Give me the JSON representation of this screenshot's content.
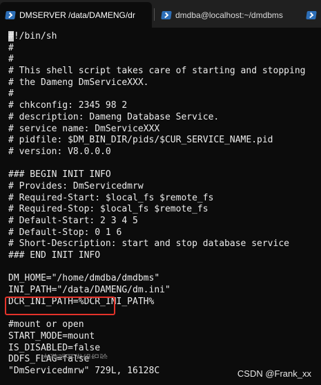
{
  "tabs": [
    {
      "title": "DMSERVER /data/DAMENG/dr",
      "active": true,
      "icon": "powershell-icon"
    },
    {
      "title": "dmdba@localhost:~/dmdbms",
      "active": false,
      "icon": "powershell-icon"
    },
    {
      "title": "",
      "active": false,
      "icon": "powershell-icon"
    }
  ],
  "terminal": {
    "lines": [
      "#!/bin/sh",
      "#",
      "#",
      "# This shell script takes care of starting and stopping",
      "# the Dameng DmServiceXXX.",
      "#",
      "# chkconfig: 2345 98 2",
      "# description: Dameng Database Service.",
      "# service name: DmServiceXXX",
      "# pidfile: $DM_BIN_DIR/pids/$CUR_SERVICE_NAME.pid",
      "# version: V8.0.0.0",
      "",
      "### BEGIN INIT INFO",
      "# Provides: DmServicedmrw",
      "# Required-Start: $local_fs $remote_fs",
      "# Required-Stop: $local_fs $remote_fs",
      "# Default-Start: 2 3 4 5",
      "# Default-Stop: 0 1 6",
      "# Short-Description: start and stop database service",
      "### END INIT INFO",
      "",
      "DM_HOME=\"/home/dmdba/dmdbms\"",
      "INI_PATH=\"/data/DAMENG/dm.ini\"",
      "DCR_INI_PATH=%DCR_INI_PATH%",
      "",
      "#mount or open",
      "START_MODE=mount",
      "IS_DISABLED=false",
      "DDFS_FLAG=false",
      "\"DmServicedmrw\" 729L, 16128C"
    ],
    "highlighted_line": "START_MODE=mount",
    "highlight_color": "#e5332a",
    "background": "#0c0c0c",
    "foreground": "#ececec"
  },
  "bottom_partial_text": "本游戏开发组织验",
  "watermark": "CSDN @Frank_xx"
}
